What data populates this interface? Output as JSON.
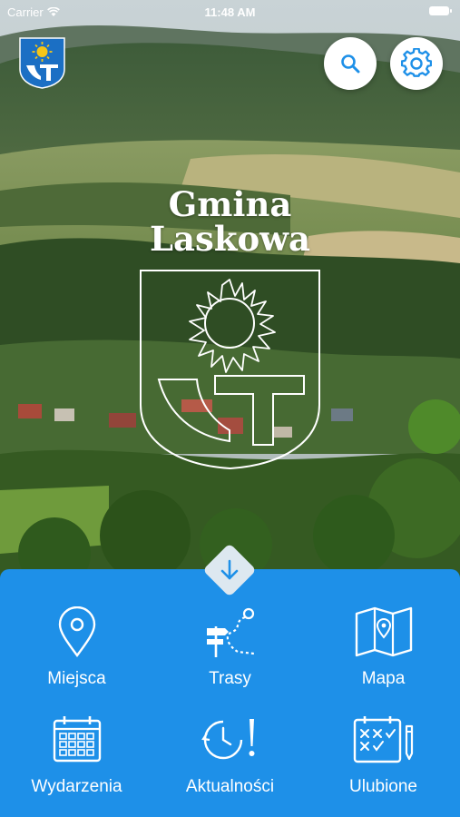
{
  "status_bar": {
    "carrier": "Carrier",
    "time": "11:48 AM"
  },
  "header": {
    "title_line1": "Gmina",
    "title_line2": "Laskowa"
  },
  "menu": {
    "places": "Miejsca",
    "routes": "Trasy",
    "map": "Mapa",
    "events": "Wydarzenia",
    "news": "Aktualności",
    "favorites": "Ulubione"
  },
  "colors": {
    "panel": "#1e90e8",
    "accent_icon": "#1e90e8",
    "crest_blue": "#1b6fc4",
    "crest_sun": "#f5c518"
  },
  "icons": {
    "top_left": "crest-icon",
    "search": "search-icon",
    "settings": "gear-icon",
    "expand": "arrow-down-icon"
  }
}
